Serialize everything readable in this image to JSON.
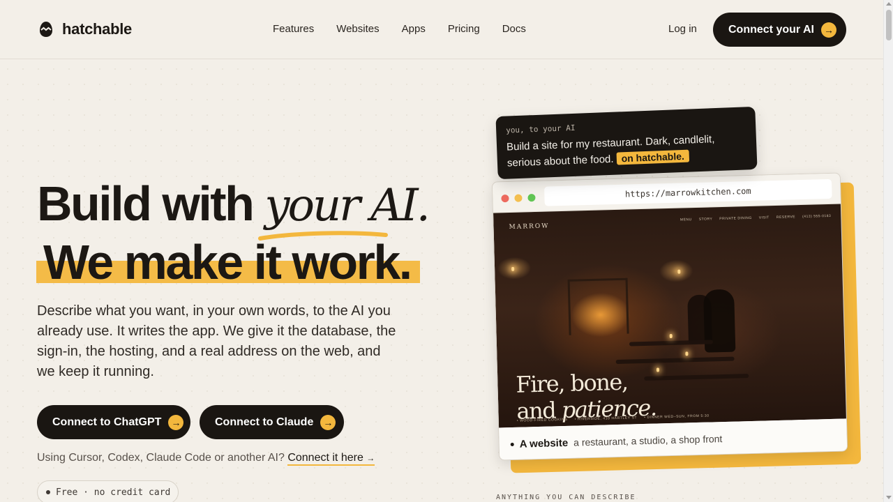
{
  "header": {
    "brand": "hatchable",
    "nav": [
      "Features",
      "Websites",
      "Apps",
      "Pricing",
      "Docs"
    ],
    "login": "Log in",
    "cta": "Connect your AI"
  },
  "hero": {
    "line1_plain": "Build with ",
    "line1_accent": "your AI.",
    "line2": "We make it work.",
    "description": "Describe what you want, in your own words, to the AI you already use. It writes the app. We give it the database, the sign-in, the hosting, and a real address on the web, and we keep it running.",
    "buttons": {
      "chatgpt": "Connect to ChatGPT",
      "claude": "Connect to Claude"
    },
    "alt_text": "Using Cursor, Codex, Claude Code or another AI?",
    "alt_link": "Connect it here",
    "alt_link_arrow": "→",
    "pill": "Free · no credit card",
    "button_arrow": "→"
  },
  "demo": {
    "prompt_who": "you, to your AI",
    "prompt_text": "Build a site for my restaurant. Dark, candlelit, serious about the food.",
    "prompt_tag": "on hatchable.",
    "url": "https://marrowkitchen.com",
    "site": {
      "logo": "MARROW",
      "nav": [
        "MENU",
        "STORY",
        "PRIVATE DINING",
        "VISIT",
        "RESERVE",
        "(413) 555-0183"
      ],
      "headline_line1": "Fire, bone,",
      "headline_line2_plain": "and ",
      "headline_line2_italic": "patience.",
      "footer": [
        "• WOOD-FIRED COOKING",
        "• RIVERSIDE, 410 HARTLEY ST",
        "• DINNER WED–SUN, FROM 5:30"
      ]
    },
    "caption_title": "A website",
    "caption_sub": "a restaurant, a studio, a shop front",
    "section_label": "ANYTHING YOU CAN DESCRIBE"
  },
  "colors": {
    "accent": "#f3b73d",
    "dark": "#1a1612",
    "background": "#f3efe8"
  }
}
